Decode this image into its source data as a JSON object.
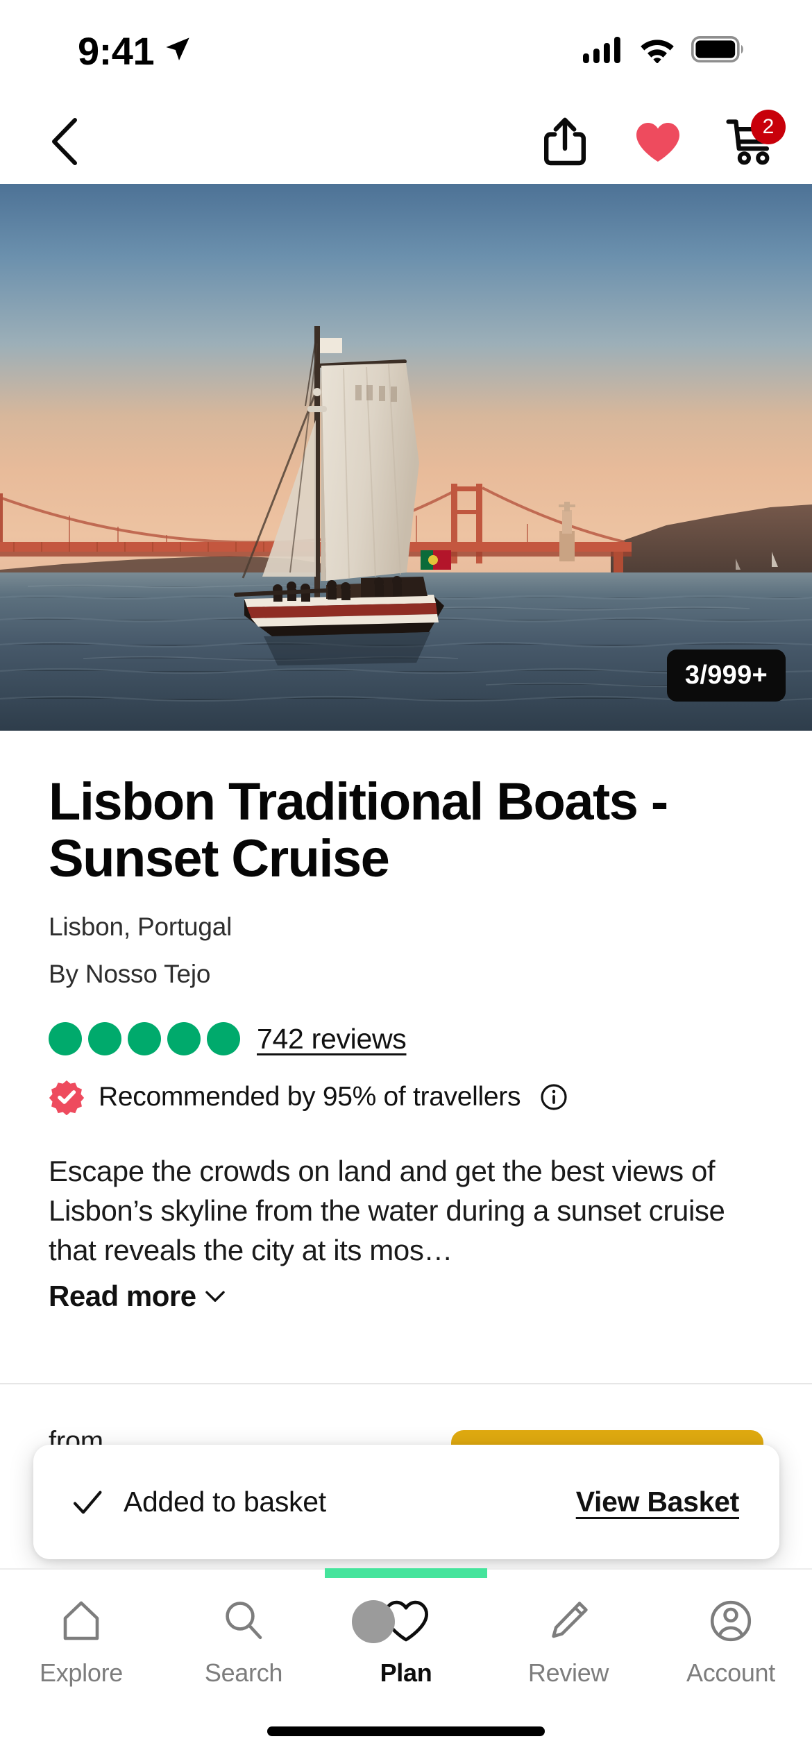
{
  "status_bar": {
    "time": "9:41",
    "location_icon": "location-arrow-icon",
    "cellular_icon": "cellular-bars-icon",
    "wifi_icon": "wifi-icon",
    "battery_icon": "battery-full-icon"
  },
  "nav_bar": {
    "back_icon": "chevron-left-icon",
    "share_icon": "share-icon",
    "favourite_icon": "heart-filled-icon",
    "cart_icon": "shopping-cart-icon",
    "cart_badge_count": "2"
  },
  "hero": {
    "image_alt": "Traditional sailboat on the Tagus river at sunset with the 25 de Abril Bridge",
    "counter": "3/999+"
  },
  "product": {
    "title": "Lisbon Traditional Boats - Sunset Cruise",
    "location": "Lisbon, Portugal",
    "supplier": "By Nosso Tejo",
    "rating_bubbles_filled": 5,
    "rating_bubbles_total": 5,
    "reviews_label": "742 reviews",
    "recommended_text": "Recommended by 95% of travellers",
    "recommended_badge_icon": "verified-check-badge-icon",
    "info_icon": "info-circle-icon",
    "description": "Escape the crowds on land and get the best views of Lisbon’s skyline from the water during a sunset cruise that reveals the city at its mos…",
    "read_more_label": "Read more",
    "read_more_icon": "chevron-down-icon"
  },
  "price_bar": {
    "from_label": "from",
    "cta_label": ""
  },
  "toast": {
    "check_icon": "check-icon",
    "message": "Added to basket",
    "action_label": "View Basket"
  },
  "tab_bar": {
    "items": [
      {
        "label": "Explore",
        "icon": "home-outline-icon",
        "active": false
      },
      {
        "label": "Search",
        "icon": "magnifier-icon",
        "active": false
      },
      {
        "label": "Plan",
        "icon": "heart-outline-icon",
        "active": true
      },
      {
        "label": "Review",
        "icon": "pencil-icon",
        "active": false
      },
      {
        "label": "Account",
        "icon": "user-circle-icon",
        "active": false
      }
    ]
  },
  "colors": {
    "rating_green": "#00AA6C",
    "accent_pink": "#EE4B5E",
    "cart_badge_red": "#C8000A",
    "cta_yellow": "#E0AA10",
    "tab_indicator_green": "#45E49C"
  }
}
